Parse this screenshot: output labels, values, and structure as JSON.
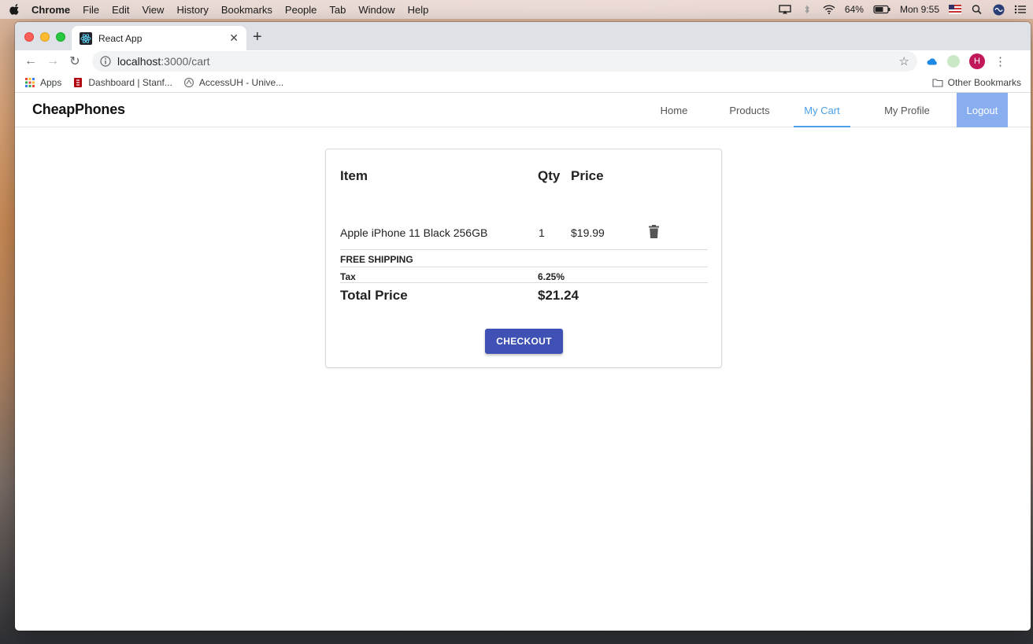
{
  "menubar": {
    "app": "Chrome",
    "items": [
      "File",
      "Edit",
      "View",
      "History",
      "Bookmarks",
      "People",
      "Tab",
      "Window",
      "Help"
    ],
    "battery": "64%",
    "clock": "Mon 9:55"
  },
  "browser": {
    "tab_title": "React App",
    "url_host": "localhost",
    "url_path": ":3000/cart",
    "profile_initial": "H",
    "bookmarks": [
      "Apps",
      "Dashboard | Stanf...",
      "AccessUH - Unive..."
    ],
    "other_bookmarks": "Other Bookmarks"
  },
  "app": {
    "brand": "CheapPhones",
    "nav": [
      "Home",
      "Products",
      "My Cart",
      "My Profile",
      "Logout"
    ],
    "active_nav": "My Cart"
  },
  "cart": {
    "headers": {
      "item": "Item",
      "qty": "Qty",
      "price": "Price"
    },
    "items": [
      {
        "name": "Apple iPhone 11 Black 256GB",
        "qty": "1",
        "price": "$19.99"
      }
    ],
    "shipping_label": "FREE SHIPPING",
    "tax_label": "Tax",
    "tax_value": "6.25%",
    "total_label": "Total Price",
    "total_value": "$21.24",
    "checkout_label": "CHECKOUT"
  },
  "colors": {
    "primary_button": "#3f51b5",
    "active_nav": "#4a9fe6",
    "logout_bg": "#88aef0"
  }
}
